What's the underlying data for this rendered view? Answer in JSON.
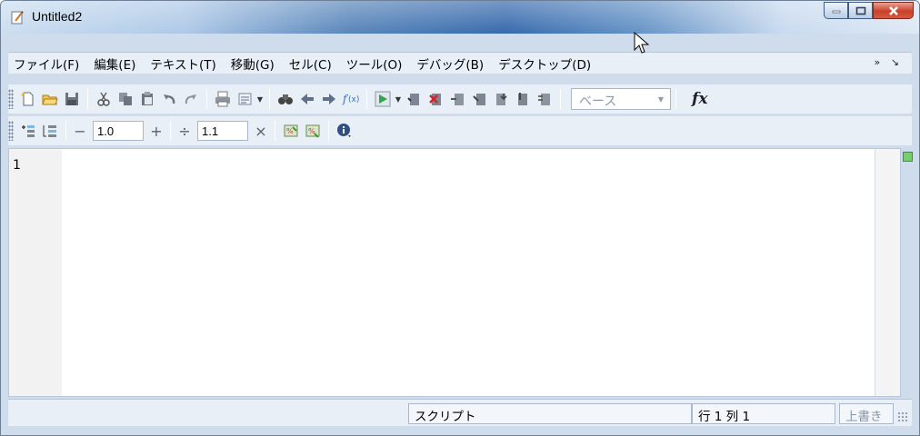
{
  "window": {
    "title": "Untitled2",
    "controls": [
      "minimize",
      "maximize",
      "close"
    ]
  },
  "menu": {
    "items": [
      "ファイル(F)",
      "編集(E)",
      "テキスト(T)",
      "移動(G)",
      "セル(C)",
      "ツール(O)",
      "デバッグ(B)",
      "デスクトップ(D)"
    ],
    "overflow": "» ↘"
  },
  "toolbar1": {
    "icons": [
      "new-file-icon",
      "open-folder-icon",
      "save-icon",
      "cut-icon",
      "copy-icon",
      "paste-icon",
      "undo-icon",
      "redo-icon",
      "print-icon",
      "comment-icon",
      "find-icon",
      "back-icon",
      "forward-icon",
      "function-icon",
      "run-icon",
      "step-icons"
    ],
    "base_combo": "ベース",
    "fx_label": "fx"
  },
  "toolbar2": {
    "decrement_symbol": "−",
    "value1": "1.0",
    "increment_symbol": "+",
    "divide_symbol": "÷",
    "value2": "1.1",
    "multiply_symbol": "×"
  },
  "editor": {
    "line_number": "1"
  },
  "status": {
    "script": "スクリプト",
    "position": "行  1     列  1",
    "mode": "上書き"
  },
  "colors": {
    "titlebar_accent": "#2c62a8",
    "toolbar_bg": "#e9eff7",
    "marker": "#77cf6c"
  }
}
